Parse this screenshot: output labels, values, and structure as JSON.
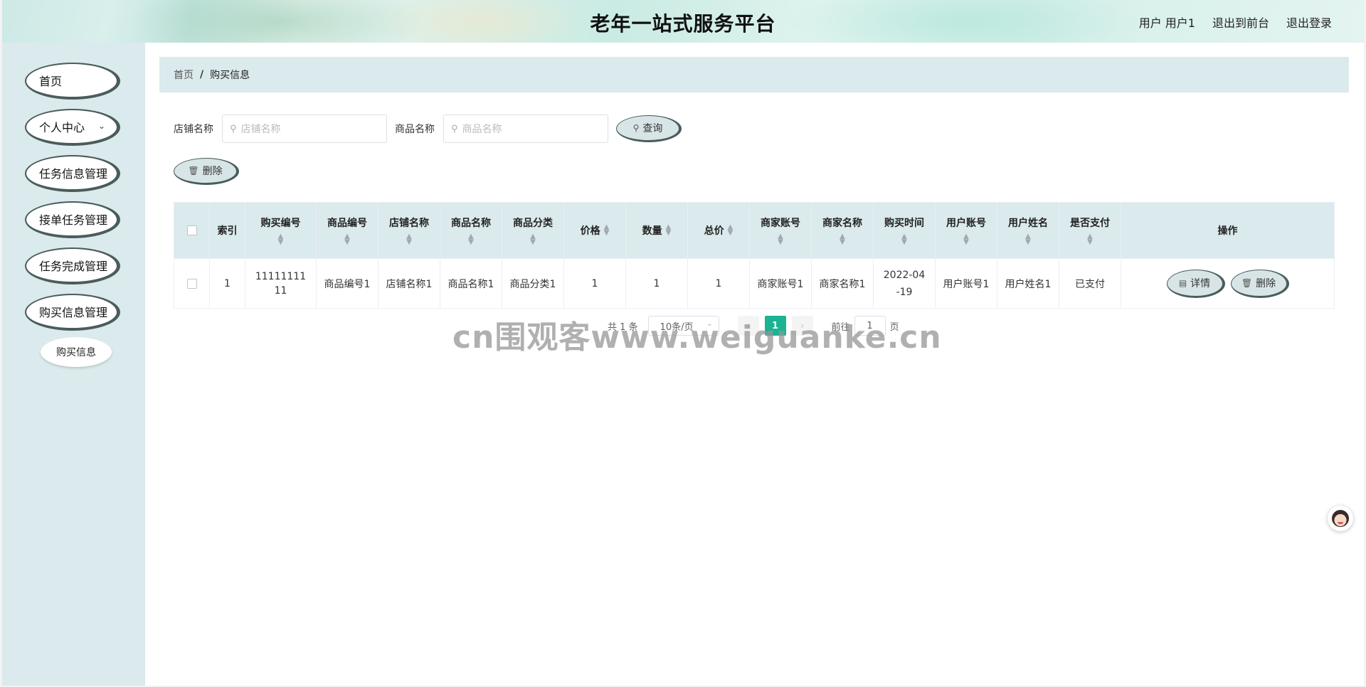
{
  "header": {
    "title": "老年一站式服务平台",
    "user_label": "用户 用户1",
    "back_to_front": "退出到前台",
    "logout": "退出登录"
  },
  "sidebar": {
    "items": [
      {
        "label": "首页"
      },
      {
        "label": "个人中心",
        "icon": "chevron-down-icon"
      },
      {
        "label": "任务信息管理"
      },
      {
        "label": "接单任务管理"
      },
      {
        "label": "任务完成管理"
      },
      {
        "label": "购买信息管理"
      }
    ],
    "sub_item": "购买信息"
  },
  "breadcrumb": {
    "home": "首页",
    "separator": "/",
    "current": "购买信息"
  },
  "search": {
    "shop_label": "店铺名称",
    "shop_placeholder": "店铺名称",
    "product_label": "商品名称",
    "product_placeholder": "商品名称",
    "query_button": "查询"
  },
  "toolbar": {
    "delete_button": "删除"
  },
  "table": {
    "columns": [
      "索引",
      "购买编号",
      "商品编号",
      "店铺名称",
      "商品名称",
      "商品分类",
      "价格",
      "数量",
      "总价",
      "商家账号",
      "商家名称",
      "购买时间",
      "用户账号",
      "用户姓名",
      "是否支付",
      "操作"
    ],
    "rows": [
      {
        "index": "1",
        "purchase_no": "1111111111",
        "product_no": "商品编号1",
        "shop_name": "店铺名称1",
        "product_name": "商品名称1",
        "category": "商品分类1",
        "price": "1",
        "quantity": "1",
        "total": "1",
        "merchant_account": "商家账号1",
        "merchant_name": "商家名称1",
        "purchase_time": "2022-04-19",
        "user_account": "用户账号1",
        "user_name": "用户姓名1",
        "paid": "已支付",
        "detail_button": "详情",
        "delete_button": "删除"
      }
    ]
  },
  "pagination": {
    "total": "共 1 条",
    "page_size": "10条/页",
    "current_page": "1",
    "goto_label": "前往",
    "goto_value": "1",
    "page_suffix": "页"
  },
  "watermark": "cn围观客www.weiguanke.cn",
  "colors": {
    "accent": "#1ab394",
    "sidebar_bg": "#dbeaec",
    "button_bg": "#d7e5e6"
  }
}
